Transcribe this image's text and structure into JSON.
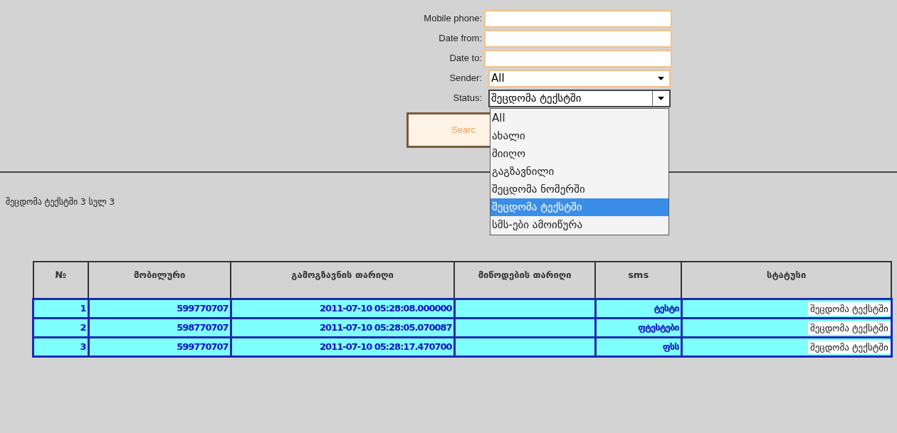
{
  "form": {
    "fields": [
      {
        "label": "Mobile phone:",
        "kind": "text"
      },
      {
        "label": "Date from:",
        "kind": "text"
      },
      {
        "label": "Date to:",
        "kind": "text"
      },
      {
        "label": "Sender:",
        "kind": "select",
        "value": "All",
        "expanded": false
      },
      {
        "label": "Status:",
        "kind": "select",
        "value": "შეცდომა ტექსტში",
        "expanded": true
      }
    ],
    "search_button": "Searc",
    "status_options": [
      {
        "label": "All",
        "selected": false
      },
      {
        "label": "ახალი",
        "selected": false
      },
      {
        "label": "მიიღო",
        "selected": false
      },
      {
        "label": "გაგზავნილი",
        "selected": false
      },
      {
        "label": "შეცდომა ნომერში",
        "selected": false
      },
      {
        "label": "შეცდომა ტექსტში",
        "selected": true
      },
      {
        "label": "სმს-ები ამოიწურა",
        "selected": false
      }
    ]
  },
  "summary": "შეცდომა ტექსტში 3 სულ 3",
  "table": {
    "columns": [
      "№",
      "მობილური",
      "გამოგზავნის თარიღი",
      "მიწოდების თარიღი",
      "sms",
      "სტატუსი"
    ],
    "rows": [
      [
        "1",
        "599770707",
        "2011-07-10 05:28:08.000000",
        "",
        "ტესტი",
        "შეცდომა ტექსტში"
      ],
      [
        "2",
        "598770707",
        "2011-07-10 05:28:05.070087",
        "",
        "ფტესტები",
        "შეცდომა ტექსტში"
      ],
      [
        "3",
        "599770707",
        "2011-07-10 05:28:17.470700",
        "",
        "ფსს",
        "შეცდომა ტექსტში"
      ]
    ]
  }
}
